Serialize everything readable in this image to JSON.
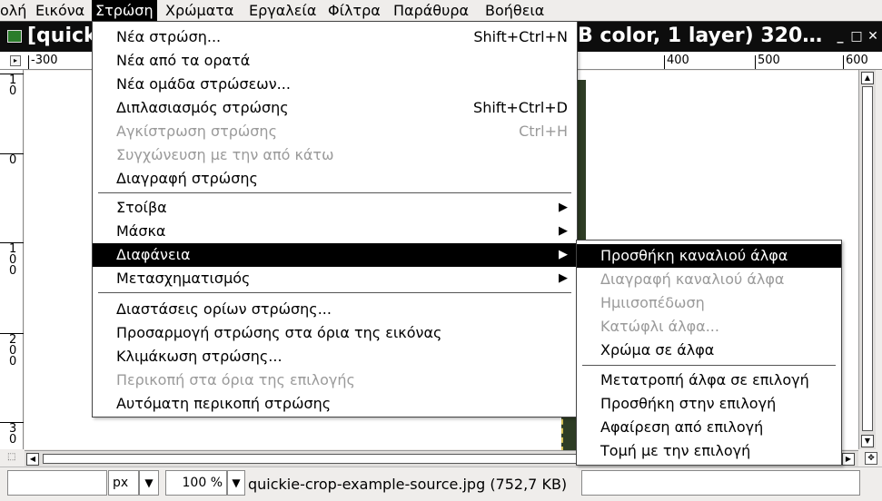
{
  "menubar": {
    "items": [
      "ολή",
      "Εικόνα",
      "Στρώση",
      "Χρώματα",
      "Εργαλεία",
      "Φίλτρα",
      "Παράθυρα",
      "Βοήθεια"
    ]
  },
  "window": {
    "title_left": "[quick",
    "title_right": "B color, 1 layer) 320…",
    "btn_minimize": "_",
    "btn_maximize": "□",
    "btn_close": "✕"
  },
  "ruler_h": {
    "labels": [
      "-300",
      "400",
      "500",
      "600"
    ]
  },
  "ruler_v": {
    "labels": [
      "1\n0",
      "0",
      "1\n0\n0",
      "2\n0\n0",
      "3\n0"
    ]
  },
  "layer_menu": {
    "items": [
      {
        "label": "Νέα στρώση...",
        "shortcut": "Shift+Ctrl+N",
        "enabled": true
      },
      {
        "label": "Νέα από τα ορατά",
        "shortcut": "",
        "enabled": true
      },
      {
        "label": "Νέα ομάδα στρώσεων...",
        "shortcut": "",
        "enabled": true
      },
      {
        "label": "Διπλασιασμός στρώσης",
        "shortcut": "Shift+Ctrl+D",
        "enabled": true
      },
      {
        "label": "Αγκίστρωση στρώσης",
        "shortcut": "Ctrl+H",
        "enabled": false
      },
      {
        "label": "Συγχώνευση με την από κάτω",
        "shortcut": "",
        "enabled": false
      },
      {
        "label": "Διαγραφή στρώσης",
        "shortcut": "",
        "enabled": true
      },
      {
        "label": "Στοίβα",
        "submenu": true,
        "enabled": true
      },
      {
        "label": "Μάσκα",
        "submenu": true,
        "enabled": true
      },
      {
        "label": "Διαφάνεια",
        "submenu": true,
        "enabled": true,
        "highlighted": true
      },
      {
        "label": "Μετασχηματισμός",
        "submenu": true,
        "enabled": true
      },
      {
        "label": "Διαστάσεις ορίων στρώσης...",
        "shortcut": "",
        "enabled": true
      },
      {
        "label": "Προσαρμογή στρώσης στα όρια της εικόνας",
        "shortcut": "",
        "enabled": true
      },
      {
        "label": "Κλιμάκωση στρώσης...",
        "shortcut": "",
        "enabled": true
      },
      {
        "label": "Περικοπή στα όρια της επιλογής",
        "shortcut": "",
        "enabled": false
      },
      {
        "label": "Αυτόματη περικοπή στρώσης",
        "shortcut": "",
        "enabled": true
      }
    ]
  },
  "transparency_menu": {
    "items": [
      {
        "label": "Προσθήκη καναλιού άλφα",
        "enabled": true,
        "highlighted": true
      },
      {
        "label": "Διαγραφή καναλιού άλφα",
        "enabled": false
      },
      {
        "label": "Ημιισοπέδωση",
        "enabled": false
      },
      {
        "label": "Κατώφλι άλφα...",
        "enabled": false
      },
      {
        "label": "Χρώμα σε άλφα",
        "enabled": true
      },
      {
        "label": "Μετατροπή άλφα σε επιλογή",
        "enabled": true
      },
      {
        "label": "Προσθήκη στην επιλογή",
        "enabled": true
      },
      {
        "label": "Αφαίρεση από επιλογή",
        "enabled": true
      },
      {
        "label": "Τομή με την επιλογή",
        "enabled": true
      }
    ]
  },
  "statusbar": {
    "unit": "px",
    "zoom": "100 %",
    "file_info": "quickie-crop-example-source.jpg (752,7 KB)"
  }
}
